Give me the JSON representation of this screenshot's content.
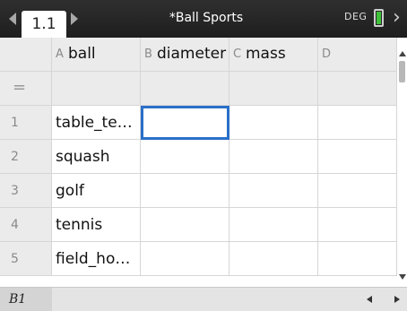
{
  "header": {
    "page_tab": "1.1",
    "document_title": "*Ball Sports",
    "angle_mode": "DEG",
    "icons": [
      "prev-page-arrow-icon",
      "next-page-arrow-icon",
      "battery-icon",
      "close-chevron-icon"
    ],
    "battery_color": "#3ec23a"
  },
  "spreadsheet": {
    "columns": [
      {
        "letter": "A",
        "name": "ball"
      },
      {
        "letter": "B",
        "name": "diameter"
      },
      {
        "letter": "C",
        "name": "mass"
      },
      {
        "letter": "D",
        "name": ""
      }
    ],
    "formula_row_symbol": "=",
    "rows": [
      {
        "num": "1",
        "a": "table_te…",
        "b": "",
        "c": "",
        "d": ""
      },
      {
        "num": "2",
        "a": "squash",
        "b": "",
        "c": "",
        "d": ""
      },
      {
        "num": "3",
        "a": "golf",
        "b": "",
        "c": "",
        "d": ""
      },
      {
        "num": "4",
        "a": "tennis",
        "b": "",
        "c": "",
        "d": ""
      },
      {
        "num": "5",
        "a": "field_ho…",
        "b": "",
        "c": "",
        "d": ""
      }
    ],
    "selected_cell": "B1",
    "selection_color": "#2a6fc9"
  },
  "statusbar": {
    "cell_reference": "B1"
  }
}
